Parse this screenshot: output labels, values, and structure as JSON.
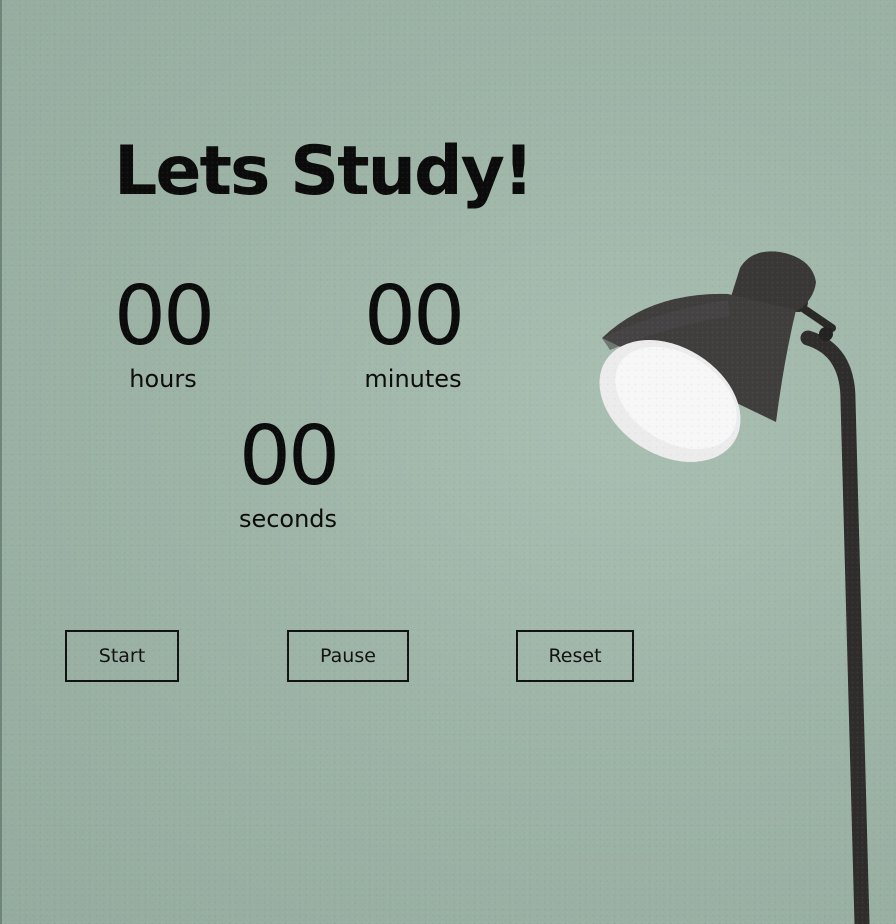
{
  "title": "Lets Study!",
  "timer": {
    "hours": {
      "value": "00",
      "label": "hours"
    },
    "minutes": {
      "value": "00",
      "label": "minutes"
    },
    "seconds": {
      "value": "00",
      "label": "seconds"
    }
  },
  "controls": {
    "start_label": "Start",
    "pause_label": "Pause",
    "reset_label": "Reset"
  },
  "background": {
    "image": "floor-lamp",
    "wall_color": "#9db4a7"
  }
}
